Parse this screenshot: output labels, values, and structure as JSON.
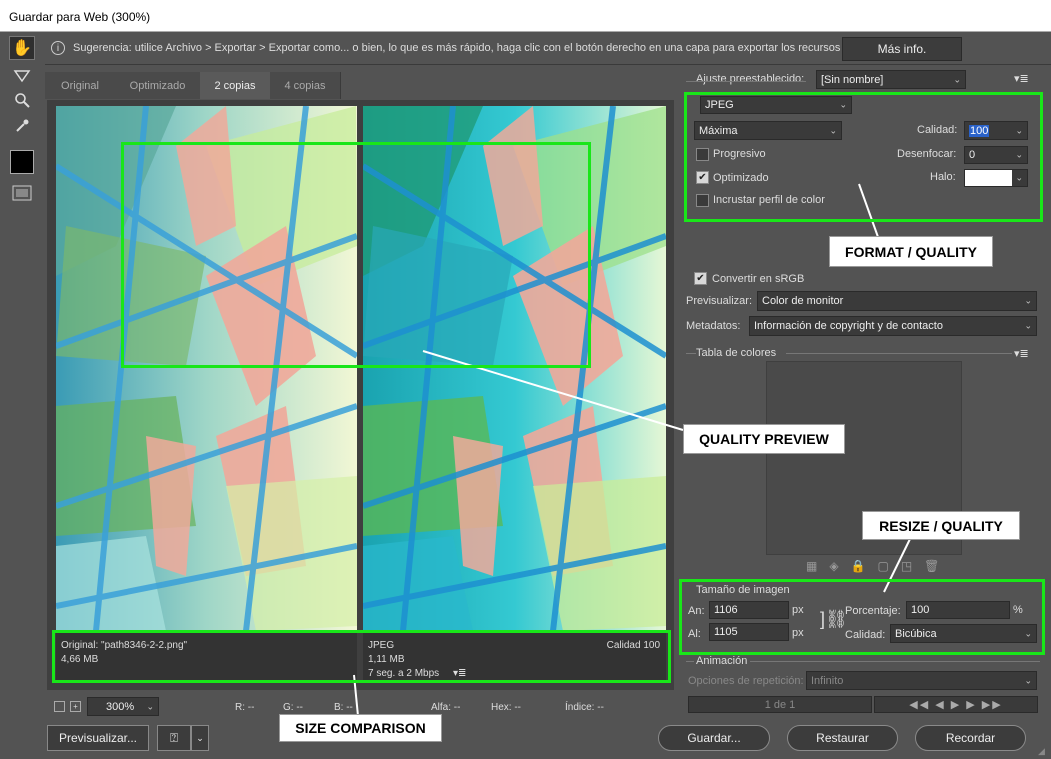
{
  "window": {
    "title": "Guardar para Web (300%)"
  },
  "hint": {
    "text": "Sugerencia: utilice Archivo > Exportar > Exportar como... o bien, lo que es más rápido, haga clic con el botón derecho en una capa para exportar los recursos",
    "more_button": "Más info."
  },
  "tabs": [
    "Original",
    "Optimizado",
    "2 copias",
    "4 copias"
  ],
  "active_tab": "2 copias",
  "panes": {
    "left": {
      "line1": "Original: \"path8346-2-2.png\"",
      "line2": "4,66 MB"
    },
    "right": {
      "format": "JPEG",
      "size": "1,11 MB",
      "time": "7 seg. a 2 Mbps",
      "menu": "▾≣",
      "quality": "Calidad 100"
    }
  },
  "callouts": {
    "format_quality": "FORMAT / QUALITY",
    "quality_preview": "QUALITY PREVIEW",
    "resize_quality": "RESIZE / QUALITY",
    "size_comparison": "SIZE COMPARISON"
  },
  "status": {
    "zoom": "300%",
    "r": "R: --",
    "g": "G: --",
    "b": "B: --",
    "alfa": "Alfa: --",
    "hex": "Hex: --",
    "indice": "Índice: --"
  },
  "buttons": {
    "preview": "Previsualizar...",
    "save": "Guardar...",
    "restore": "Restaurar",
    "remember": "Recordar"
  },
  "settings": {
    "preset_label": "Ajuste preestablecido:",
    "preset_value": "[Sin nombre]",
    "format": "JPEG",
    "quality_preset": "Máxima",
    "quality_label": "Calidad:",
    "quality_value": "100",
    "blur_label": "Desenfocar:",
    "blur_value": "0",
    "matte_label": "Halo:",
    "progressive": "Progresivo",
    "optimized": "Optimizado",
    "embed_profile": "Incrustar perfil de color",
    "convert_srgb": "Convertir en sRGB",
    "preview_label": "Previsualizar:",
    "preview_value": "Color de monitor",
    "metadata_label": "Metadatos:",
    "metadata_value": "Información de copyright y de contacto",
    "color_table": "Tabla de colores",
    "image_size_title": "Tamaño de imagen",
    "width_label": "An:",
    "width_value": "1106",
    "height_label": "Al:",
    "height_value": "1105",
    "unit": "px",
    "percent_label": "Porcentaje:",
    "percent_value": "100",
    "percent_unit": "%",
    "resample_label": "Calidad:",
    "resample_value": "Bicúbica",
    "animation_title": "Animación",
    "loop_label": "Opciones de repetición:",
    "loop_value": "Infinito",
    "frame_counter": "1 de 1"
  },
  "checks": {
    "progressive": false,
    "optimized": true,
    "embed_profile": false,
    "convert_srgb": true
  },
  "colors": {
    "highlight": "#19e619",
    "panel": "#535353"
  }
}
